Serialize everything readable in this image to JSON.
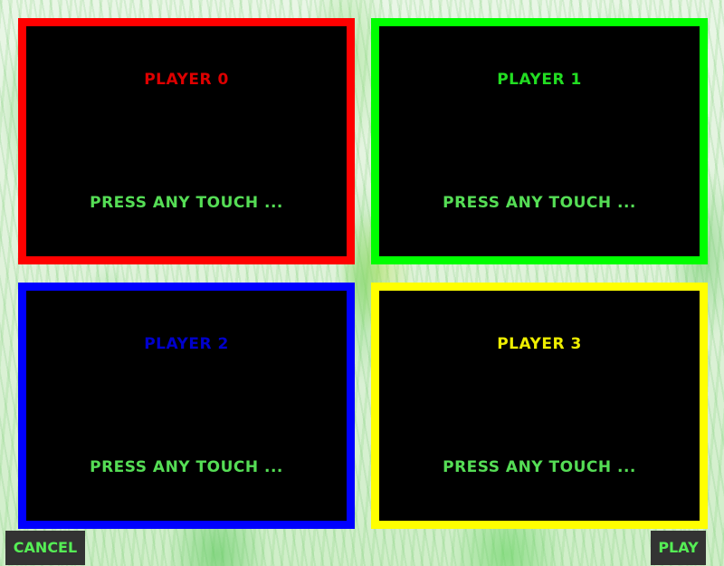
{
  "colors": {
    "player0": "#ff0000",
    "player1": "#00ff00",
    "player2": "#0000ff",
    "player3": "#ffff00",
    "player0_text": "#dd0000",
    "player1_text": "#22dd22",
    "player2_text": "#0000cc",
    "player3_text": "#eeee00",
    "prompt_text": "#55dd55",
    "button_text": "#55ee55",
    "button_bg": "#333333"
  },
  "players": [
    {
      "label": "PLAYER 0",
      "prompt": "PRESS ANY TOUCH ..."
    },
    {
      "label": "PLAYER 1",
      "prompt": "PRESS ANY TOUCH ..."
    },
    {
      "label": "PLAYER 2",
      "prompt": "PRESS ANY TOUCH ..."
    },
    {
      "label": "PLAYER 3",
      "prompt": "PRESS ANY TOUCH ..."
    }
  ],
  "buttons": {
    "cancel": "CANCEL",
    "play": "PLAY"
  }
}
